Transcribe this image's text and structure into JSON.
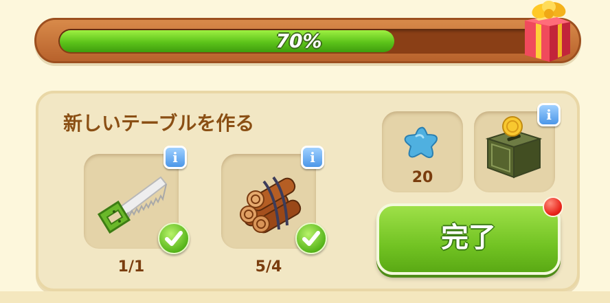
{
  "progress": {
    "percent_label": "70%",
    "fraction": 0.7
  },
  "gift": {
    "icon": "gift-box-icon"
  },
  "task": {
    "title": "新しいテーブルを作る",
    "requirements": [
      {
        "icon": "saw-icon",
        "count": "1/1",
        "completed": true
      },
      {
        "icon": "wood-logs-icon",
        "count": "5/4",
        "completed": true
      }
    ],
    "rewards": [
      {
        "icon": "blue-star-icon",
        "count": "20"
      },
      {
        "icon": "coin-box-icon",
        "count": ""
      }
    ],
    "info_label": "i",
    "complete_button": "完了"
  },
  "colors": {
    "title": "#8a4f14",
    "progress_fill": "#5cc31a",
    "button": "#72c323",
    "info": "#4c97e8",
    "notification": "#e8241a"
  }
}
